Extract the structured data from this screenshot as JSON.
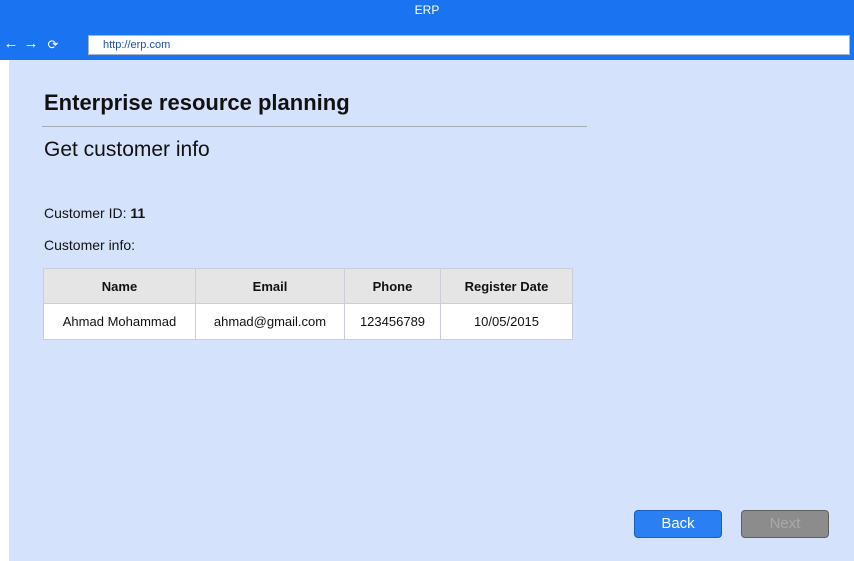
{
  "window": {
    "title": "ERP"
  },
  "browser": {
    "back_icon": "←",
    "forward_icon": "→",
    "refresh_icon": "⟳",
    "url": "http://erp.com"
  },
  "page": {
    "app_title": "Enterprise resource planning",
    "subtitle": "Get customer info",
    "customer_id_label": "Customer ID:",
    "customer_id_value": "11",
    "customer_info_label": "Customer info:"
  },
  "table": {
    "headers": [
      "Name",
      "Email",
      "Phone",
      "Register Date"
    ],
    "rows": [
      [
        "Ahmad Mohammad",
        "ahmad@gmail.com",
        "123456789",
        "10/05/2015"
      ]
    ]
  },
  "buttons": {
    "back_label": "Back",
    "next_label": "Next"
  },
  "colors": {
    "chrome": "#1a73f0",
    "page_background": "#d4e3fb",
    "primary_button": "#2a80f3",
    "disabled_button": "#8c8c8c"
  }
}
